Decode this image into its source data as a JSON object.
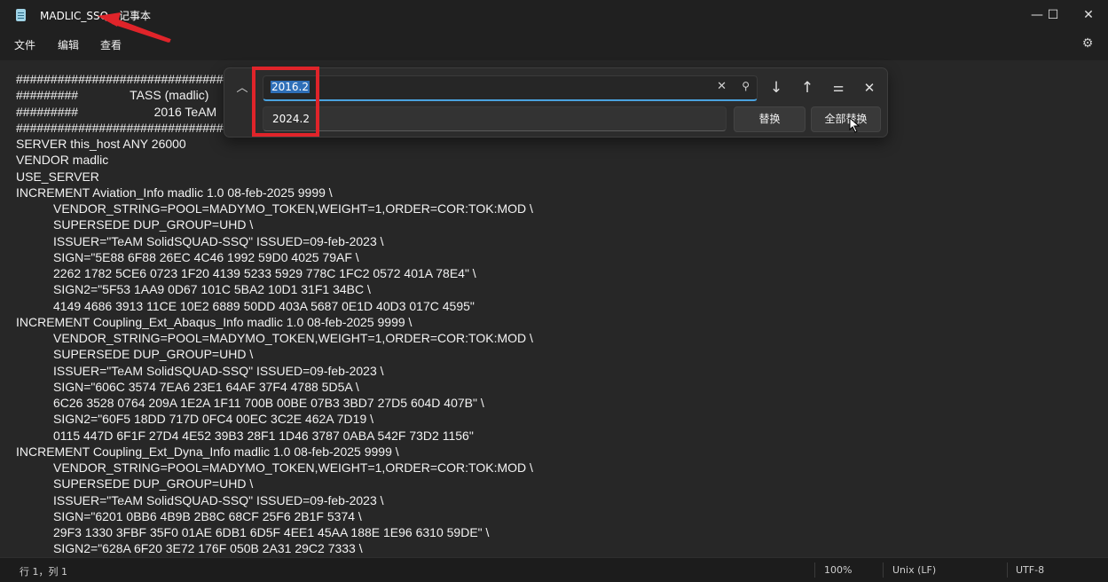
{
  "window": {
    "title": "MADLIC_SSQ - 记事本",
    "controls": {
      "minimize": "—",
      "maximize": "☐",
      "close": "✕"
    }
  },
  "menu": {
    "file": "文件",
    "edit": "编辑",
    "view": "查看"
  },
  "icons": {
    "app": "notepad-icon",
    "settings": "gear-icon",
    "collapse": "chevron-up-icon",
    "clear": "close-icon",
    "search": "search-icon",
    "next": "arrow-down-icon",
    "prev": "arrow-up-icon",
    "options": "sliders-icon",
    "close": "close-icon"
  },
  "find_replace": {
    "find_value": "2016.2",
    "replace_value": "2024.2",
    "replace_label": "替换",
    "replace_all_label": "全部替换"
  },
  "editor": {
    "lines": [
      {
        "text": "################################################",
        "indent": false
      },
      {
        "text": "#########               TASS (madlic)",
        "indent": false
      },
      {
        "text": "#########                      2016 TeAM",
        "indent": false
      },
      {
        "text": "################################################",
        "indent": false
      },
      {
        "text": "SERVER this_host ANY 26000",
        "indent": false
      },
      {
        "text": "VENDOR madlic",
        "indent": false
      },
      {
        "text": "USE_SERVER",
        "indent": false
      },
      {
        "text": "INCREMENT Aviation_Info madlic 1.0 08-feb-2025 9999 \\",
        "indent": false
      },
      {
        "text": "VENDOR_STRING=POOL=MADYMO_TOKEN,WEIGHT=1,ORDER=COR:TOK:MOD \\",
        "indent": true
      },
      {
        "text": "SUPERSEDE DUP_GROUP=UHD \\",
        "indent": true
      },
      {
        "text": "ISSUER=\"TeAM SolidSQUAD-SSQ\" ISSUED=09-feb-2023 \\",
        "indent": true
      },
      {
        "text": "SIGN=\"5E88 6F88 26EC 4C46 1992 59D0 4025 79AF \\",
        "indent": true
      },
      {
        "text": "2262 1782 5CE6 0723 1F20 4139 5233 5929 778C 1FC2 0572 401A 78E4\" \\",
        "indent": true
      },
      {
        "text": "SIGN2=\"5F53 1AA9 0D67 101C 5BA2 10D1 31F1 34BC \\",
        "indent": true
      },
      {
        "text": "4149 4686 3913 11CE 10E2 6889 50DD 403A 5687 0E1D 40D3 017C 4595\"",
        "indent": true
      },
      {
        "text": "INCREMENT Coupling_Ext_Abaqus_Info madlic 1.0 08-feb-2025 9999 \\",
        "indent": false
      },
      {
        "text": "VENDOR_STRING=POOL=MADYMO_TOKEN,WEIGHT=1,ORDER=COR:TOK:MOD \\",
        "indent": true
      },
      {
        "text": "SUPERSEDE DUP_GROUP=UHD \\",
        "indent": true
      },
      {
        "text": "ISSUER=\"TeAM SolidSQUAD-SSQ\" ISSUED=09-feb-2023 \\",
        "indent": true
      },
      {
        "text": "SIGN=\"606C 3574 7EA6 23E1 64AF 37F4 4788 5D5A \\",
        "indent": true
      },
      {
        "text": "6C26 3528 0764 209A 1E2A 1F11 700B 00BE 07B3 3BD7 27D5 604D 407B\" \\",
        "indent": true
      },
      {
        "text": "SIGN2=\"60F5 18DD 717D 0FC4 00EC 3C2E 462A 7D19 \\",
        "indent": true
      },
      {
        "text": "0115 447D 6F1F 27D4 4E52 39B3 28F1 1D46 3787 0ABA 542F 73D2 1156\"",
        "indent": true
      },
      {
        "text": "INCREMENT Coupling_Ext_Dyna_Info madlic 1.0 08-feb-2025 9999 \\",
        "indent": false
      },
      {
        "text": "VENDOR_STRING=POOL=MADYMO_TOKEN,WEIGHT=1,ORDER=COR:TOK:MOD \\",
        "indent": true
      },
      {
        "text": "SUPERSEDE DUP_GROUP=UHD \\",
        "indent": true
      },
      {
        "text": "ISSUER=\"TeAM SolidSQUAD-SSQ\" ISSUED=09-feb-2023 \\",
        "indent": true
      },
      {
        "text": "SIGN=\"6201 0BB6 4B9B 2B8C 68CF 25F6 2B1F 5374 \\",
        "indent": true
      },
      {
        "text": "29F3 1330 3FBF 35F0 01AE 6DB1 6D5F 4EE1 45AA 188E 1E96 6310 59DE\" \\",
        "indent": true
      },
      {
        "text": "SIGN2=\"628A 6F20 3E72 176F 050B 2A31 29C2 7333 \\",
        "indent": true
      }
    ]
  },
  "status": {
    "position": "行 1，列 1",
    "zoom": "100%",
    "line_ending": "Unix (LF)",
    "encoding": "UTF-8"
  },
  "colors": {
    "highlight_box": "#e0242a",
    "selection": "#2f6fb8",
    "focus_underline": "#4aa3df"
  }
}
